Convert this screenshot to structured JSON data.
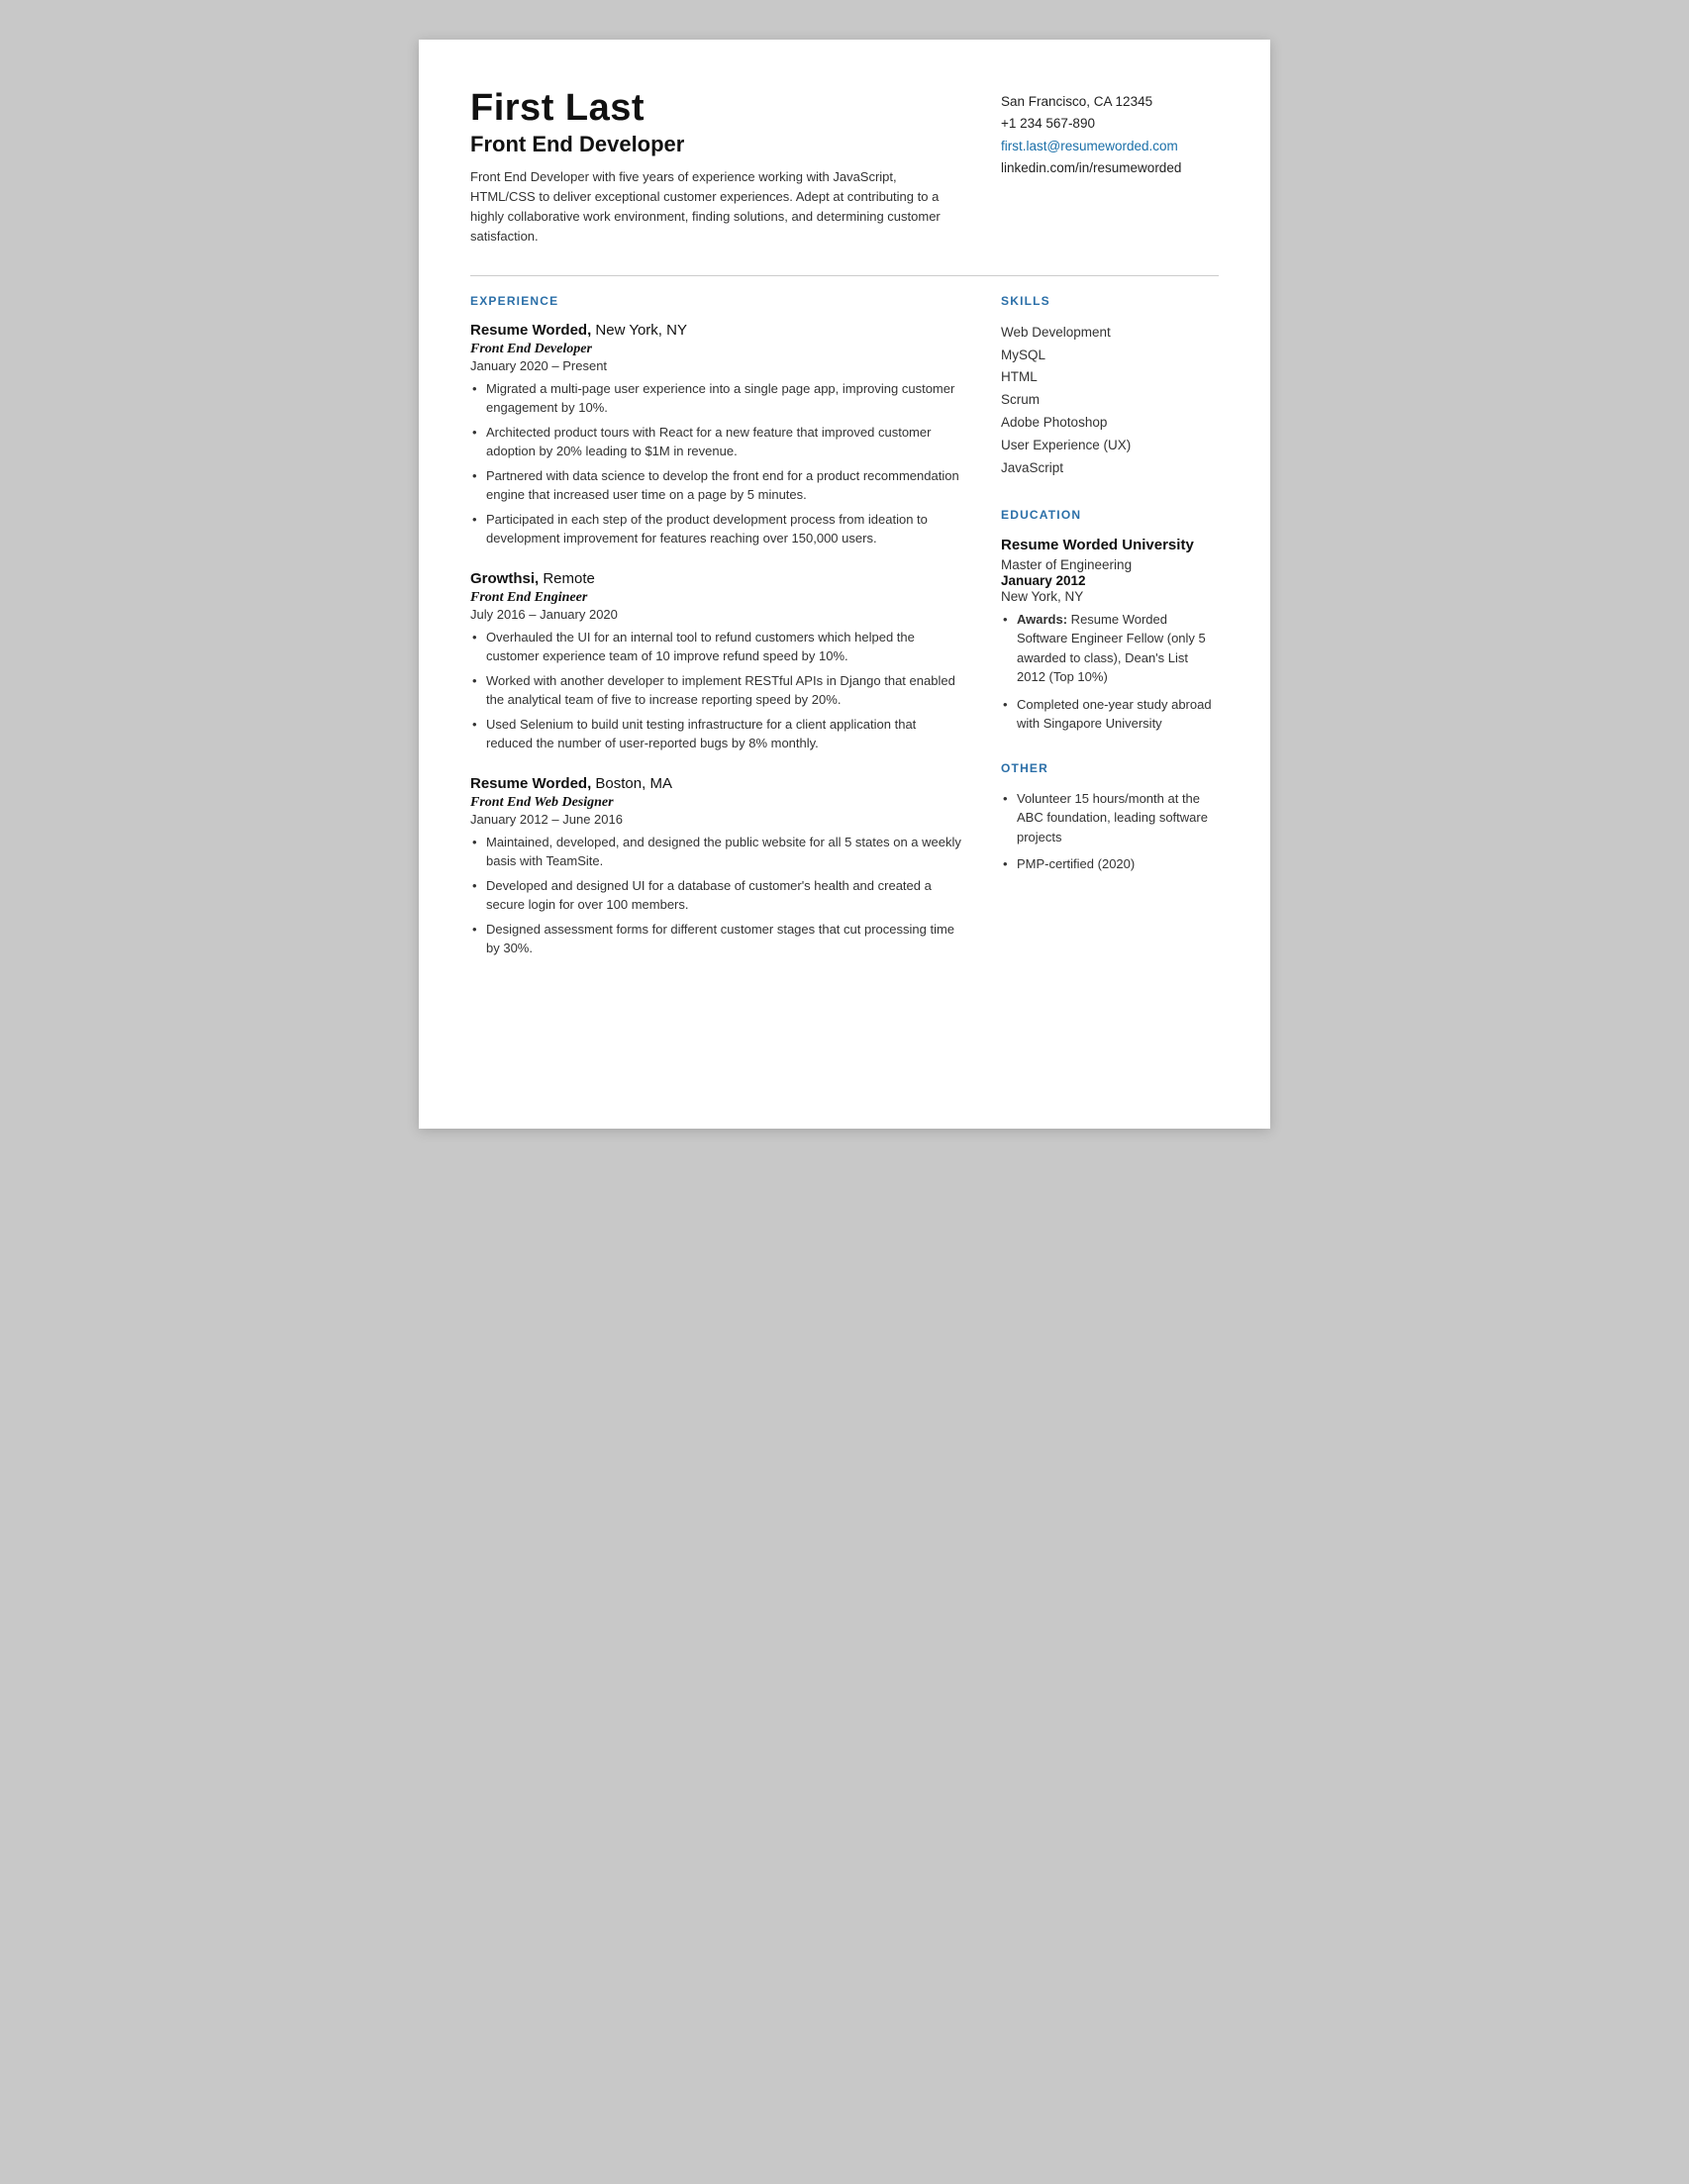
{
  "header": {
    "name": "First Last",
    "title": "Front End Developer",
    "summary": "Front End Developer with five years of experience working with JavaScript, HTML/CSS to deliver exceptional customer experiences. Adept at contributing to a highly collaborative work environment, finding solutions, and determining customer satisfaction.",
    "contact": {
      "location": "San Francisco, CA 12345",
      "phone": "+1 234 567-890",
      "email": "first.last@resumeworded.com",
      "linkedin": "linkedin.com/in/resumeworded"
    }
  },
  "sections": {
    "experience_heading": "EXPERIENCE",
    "skills_heading": "SKILLS",
    "education_heading": "EDUCATION",
    "other_heading": "OTHER"
  },
  "experience": [
    {
      "company_bold": "Resume Worded,",
      "company_normal": " New York, NY",
      "role": "Front End Developer",
      "dates": "January 2020 – Present",
      "bullets": [
        "Migrated a multi-page user experience into a single page app, improving customer engagement by 10%.",
        "Architected product tours with React for a new feature that improved customer adoption by 20% leading to $1M in revenue.",
        "Partnered with data science to develop the front end for a product recommendation engine that increased user time on a page by 5 minutes.",
        "Participated in each step of the product development process from ideation to development improvement for features reaching over 150,000 users."
      ]
    },
    {
      "company_bold": "Growthsi,",
      "company_normal": " Remote",
      "role": "Front End Engineer",
      "dates": "July 2016 – January 2020",
      "bullets": [
        "Overhauled the UI for an internal tool to refund customers which helped the customer experience team of 10 improve refund speed by 10%.",
        "Worked with another developer to implement RESTful APIs in Django that enabled the analytical team of five to increase reporting speed by 20%.",
        "Used Selenium to build unit testing infrastructure for a client application that reduced the number of user-reported bugs by 8% monthly."
      ]
    },
    {
      "company_bold": "Resume Worded,",
      "company_normal": " Boston, MA",
      "role": "Front End Web Designer",
      "dates": "January 2012 – June 2016",
      "bullets": [
        "Maintained, developed, and designed the public website for all 5 states on a weekly basis with TeamSite.",
        "Developed and designed UI for a database of customer's health and created a secure login for over 100 members.",
        "Designed assessment forms for different customer stages that cut processing time by 30%."
      ]
    }
  ],
  "skills": [
    "Web Development",
    "MySQL",
    "HTML",
    "Scrum",
    "Adobe Photoshop",
    "User Experience (UX)",
    "JavaScript"
  ],
  "education": [
    {
      "school": "Resume Worded University",
      "degree": "Master of Engineering",
      "date": "January 2012",
      "location": "New York, NY",
      "awards": [
        {
          "bold": "Awards:",
          "text": " Resume Worded Software Engineer Fellow (only 5 awarded to class), Dean's List 2012 (Top 10%)"
        },
        {
          "bold": "",
          "text": "Completed one-year study abroad with Singapore University"
        }
      ]
    }
  ],
  "other": [
    "Volunteer 15 hours/month at the ABC foundation, leading software projects",
    "PMP-certified (2020)"
  ]
}
